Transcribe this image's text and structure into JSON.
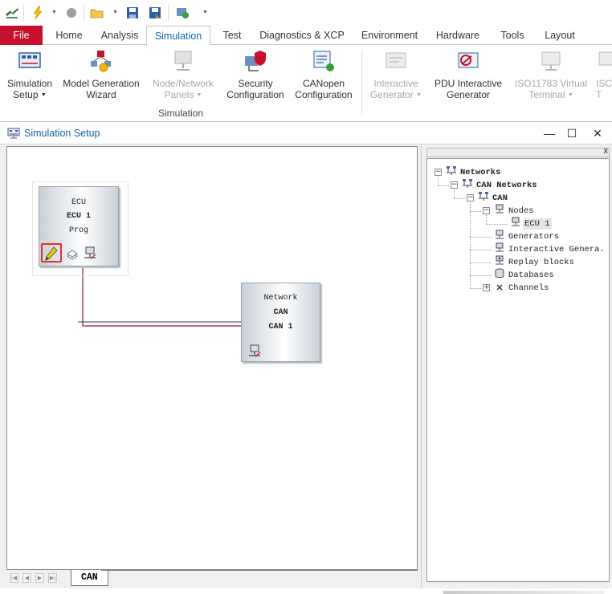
{
  "ribbon": {
    "tabs": [
      {
        "label": "File"
      },
      {
        "label": "Home"
      },
      {
        "label": "Analysis"
      },
      {
        "label": "Simulation"
      },
      {
        "label": "Test"
      },
      {
        "label": "Diagnostics & XCP"
      },
      {
        "label": "Environment"
      },
      {
        "label": "Hardware"
      },
      {
        "label": "Tools"
      },
      {
        "label": "Layout"
      }
    ],
    "active_tab": "Simulation",
    "buttons": [
      {
        "line1": "Simulation",
        "line2": "Setup",
        "icon": "simulation-setup-icon",
        "enabled": true,
        "dropdown": true
      },
      {
        "line1": "Model Generation",
        "line2": "Wizard",
        "icon": "model-generation-wizard-icon",
        "enabled": true,
        "dropdown": false
      },
      {
        "line1": "Node/Network",
        "line2": "Panels",
        "icon": "node-network-panels-icon",
        "enabled": false,
        "dropdown": true
      },
      {
        "line1": "Security",
        "line2": "Configuration",
        "icon": "security-configuration-icon",
        "enabled": true,
        "dropdown": false
      },
      {
        "line1": "CANopen",
        "line2": "Configuration",
        "icon": "canopen-configuration-icon",
        "enabled": true,
        "dropdown": false
      },
      {
        "line1": "Interactive",
        "line2": "Generator",
        "icon": "interactive-generator-icon",
        "enabled": false,
        "dropdown": true
      },
      {
        "line1": "PDU Interactive",
        "line2": "Generator",
        "icon": "pdu-interactive-generator-icon",
        "enabled": true,
        "dropdown": false
      },
      {
        "line1": "ISO11783 Virtual",
        "line2": "Terminal",
        "icon": "iso11783-virtual-terminal-icon",
        "enabled": false,
        "dropdown": true
      },
      {
        "line1": "ISC",
        "line2": "T",
        "icon": "truncated-button-icon",
        "enabled": false,
        "dropdown": false
      }
    ],
    "group_label": "Simulation"
  },
  "window": {
    "title": "Simulation Setup",
    "minimize_symbol": "—",
    "maximize_symbol": "☐",
    "close_symbol": "✕"
  },
  "canvas": {
    "ecu_block": {
      "line1": "ECU",
      "line2": "ECU 1",
      "line3": "Prog"
    },
    "network_block": {
      "line1": "Network",
      "line2": "CAN",
      "line3": "CAN 1"
    },
    "sheet_tab": "CAN",
    "colors": {
      "bus_line": "#8b1a3a",
      "highlight": "#e0312b"
    }
  },
  "tree": {
    "close_symbol": "x",
    "expander_minus": "−",
    "expander_plus": "+",
    "nodes": [
      {
        "label": "Networks"
      },
      {
        "label": "CAN Networks"
      },
      {
        "label": "CAN"
      },
      {
        "label": "Nodes"
      },
      {
        "label": "ECU 1"
      },
      {
        "label": "Generators"
      },
      {
        "label": "Interactive Genera."
      },
      {
        "label": "Replay blocks"
      },
      {
        "label": "Databases"
      },
      {
        "label": "Channels"
      }
    ]
  }
}
